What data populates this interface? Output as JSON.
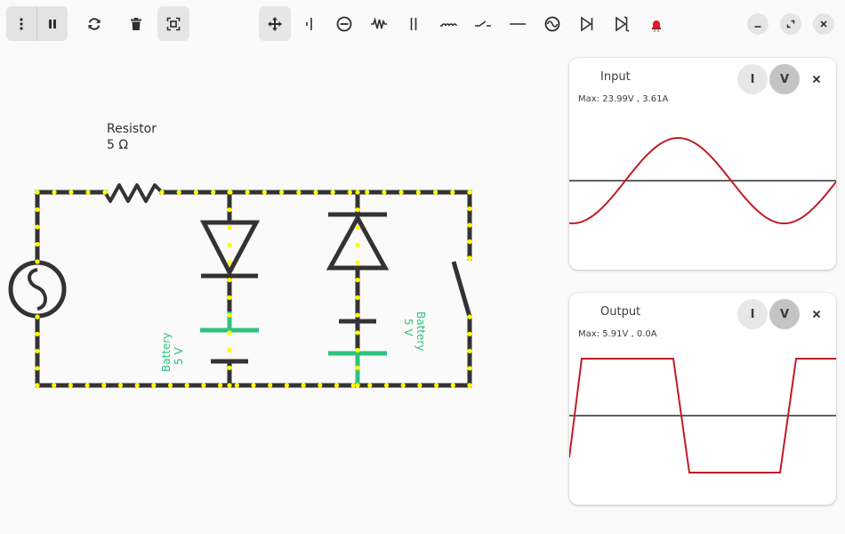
{
  "toolbar": {
    "left": [
      {
        "name": "menu-button",
        "icon": "vertical-dots-icon"
      },
      {
        "name": "pause-button",
        "icon": "pause-icon"
      },
      {
        "name": "reset-button",
        "icon": "refresh-icon"
      },
      {
        "name": "delete-button",
        "icon": "trash-icon"
      },
      {
        "name": "select-mode-button",
        "icon": "select-region-icon"
      }
    ],
    "components": [
      {
        "name": "move-tool-button",
        "icon": "move-arrows-icon",
        "active": true
      },
      {
        "name": "battery-tool-button",
        "icon": "battery-icon"
      },
      {
        "name": "current-source-tool-button",
        "icon": "current-source-icon"
      },
      {
        "name": "resistor-tool-button",
        "icon": "resistor-icon"
      },
      {
        "name": "capacitor-tool-button",
        "icon": "capacitor-icon"
      },
      {
        "name": "inductor-tool-button",
        "icon": "inductor-icon"
      },
      {
        "name": "switch-tool-button",
        "icon": "switch-icon"
      },
      {
        "name": "wire-tool-button",
        "icon": "wire-icon"
      },
      {
        "name": "ac-source-tool-button",
        "icon": "ac-source-icon"
      },
      {
        "name": "diode-tool-button",
        "icon": "diode-icon"
      },
      {
        "name": "zener-tool-button",
        "icon": "zener-icon"
      },
      {
        "name": "led-tool-button",
        "icon": "led-icon"
      }
    ],
    "window": [
      "minimize-button",
      "maximize-button",
      "close-button"
    ]
  },
  "circuit": {
    "resistor": {
      "name": "Resistor",
      "value": "5 Ω"
    },
    "battery_left": {
      "name": "Battery",
      "value": "5 V"
    },
    "battery_right": {
      "name": "Battery",
      "value": "5 V"
    },
    "colors": {
      "wire": "#333333",
      "current_dot": "#ffff00",
      "battery": "#2ec27e",
      "trace": "#c01c28"
    }
  },
  "scopes": {
    "input": {
      "title": "Input",
      "max": "Max: 23.99V , 3.61A",
      "i_label": "I",
      "v_label": "V",
      "close": "×",
      "waveform": "sine",
      "selected": "V"
    },
    "output": {
      "title": "Output",
      "max": "Max: 5.91V , 0.0A",
      "i_label": "I",
      "v_label": "V",
      "close": "×",
      "waveform": "clipped-square",
      "selected": "V"
    }
  }
}
